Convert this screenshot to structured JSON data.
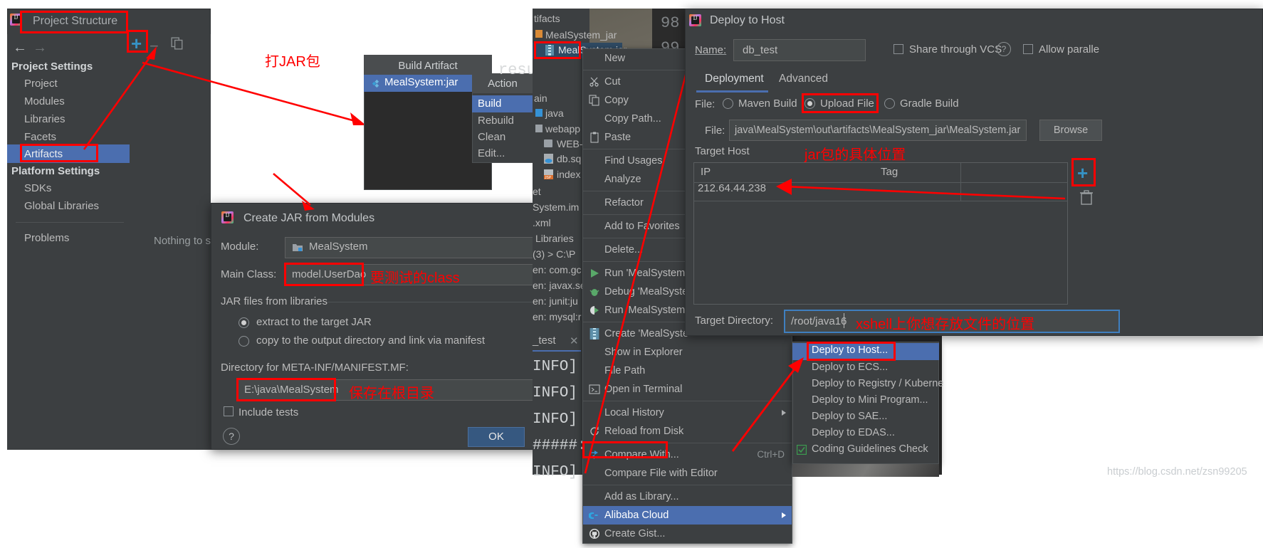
{
  "project_structure": {
    "title": "Project Structure",
    "nav": {
      "back": "←",
      "forward": "→"
    },
    "sections": [
      {
        "header": "Project Settings",
        "items": [
          "Project",
          "Modules",
          "Libraries",
          "Facets",
          "Artifacts"
        ]
      },
      {
        "header": "Platform Settings",
        "items": [
          "SDKs",
          "Global Libraries"
        ]
      }
    ],
    "problems": "Problems",
    "selected_item": "Artifacts",
    "toolbar": {
      "add": "+",
      "remove": "−",
      "copy": "copy-icon"
    },
    "empty_text": "Nothing to s"
  },
  "annotations": {
    "jar_note": "打JAR包",
    "class_note": "要测试的class",
    "root_dir_note": "保存在根目录",
    "jar_location_note": "jar包的具体位置",
    "xshell_note": "xshell上你想存放文件的位置"
  },
  "build_artifact": {
    "title": "Build Artifact",
    "item": "MealSystem:jar",
    "arrow": "▶"
  },
  "action_menu": {
    "title": "Action",
    "items": [
      "Build",
      "Rebuild",
      "Clean",
      "Edit..."
    ],
    "selected": "Build"
  },
  "create_jar_dialog": {
    "title": "Create JAR from Modules",
    "module_label": "Module:",
    "module_value": "MealSystem",
    "main_class_label": "Main Class:",
    "main_class_value": "model.UserDao",
    "jar_files_group": "JAR files from libraries",
    "radio_extract": "extract to the target JAR",
    "radio_copy": "copy to the output directory and link via manifest",
    "selected_radio": "extract to the target JAR",
    "manifest_label": "Directory for META-INF/MANIFEST.MF:",
    "manifest_value": "E:\\java\\MealSystem",
    "include_tests": "Include tests",
    "help": "?",
    "ok": "OK"
  },
  "project_tree": {
    "items": [
      "tifacts",
      "MealSystem_jar",
      "MealSystem.jar",
      "ain",
      "java",
      "webapp",
      "WEB-I",
      "db.sq",
      "index",
      "et",
      "System.im",
      ".xml",
      "Libraries",
      "(3) >   C:\\P",
      "en: com.gc",
      "en: javax.se",
      "en: junit:ju",
      "en: mysql:r",
      "_test"
    ],
    "selected": "MealSystem.jar",
    "line_numbers": [
      "98",
      "99"
    ],
    "console_lines": [
      "INFO]",
      "INFO]",
      "INFO]",
      "INFO]",
      "#####:",
      "INFO]"
    ],
    "path_hint": "C:\\P"
  },
  "context_menu": {
    "items": [
      {
        "label": "New",
        "icon": "",
        "sep_after": true
      },
      {
        "label": "Cut",
        "icon": "scissors-icon"
      },
      {
        "label": "Copy",
        "icon": "copy-icon"
      },
      {
        "label": "Copy Path...",
        "icon": ""
      },
      {
        "label": "Paste",
        "icon": "clipboard-icon",
        "sep_after": true
      },
      {
        "label": "Find Usages",
        "icon": ""
      },
      {
        "label": "Analyze",
        "icon": "",
        "sep_after": true
      },
      {
        "label": "Refactor",
        "icon": "",
        "sep_after": true
      },
      {
        "label": "Add to Favorites",
        "icon": "",
        "sep_after": true
      },
      {
        "label": "Delete...",
        "icon": "",
        "sep_after": true
      },
      {
        "label": "Run 'MealSystem.j",
        "icon": "run-icon"
      },
      {
        "label": "Debug 'MealSyste",
        "icon": "debug-icon"
      },
      {
        "label": "Run 'MealSystem.j",
        "icon": "coverage-icon",
        "sep_after": true
      },
      {
        "label": "Create 'MealSyste",
        "icon": "jar-icon"
      },
      {
        "label": "Show in Explorer",
        "icon": ""
      },
      {
        "label": "File Path",
        "icon": ""
      },
      {
        "label": "Open in Terminal",
        "icon": "terminal-icon",
        "sep_after": true
      },
      {
        "label": "Local History",
        "icon": "",
        "submenu": true
      },
      {
        "label": "Reload from Disk",
        "icon": "reload-icon",
        "sep_after": true
      },
      {
        "label": "Compare With...",
        "icon": "compare-icon",
        "shortcut": "Ctrl+D"
      },
      {
        "label": "Compare File with Editor",
        "icon": "",
        "sep_after": true
      },
      {
        "label": "Add as Library...",
        "icon": ""
      },
      {
        "label": "Alibaba Cloud",
        "icon": "alibaba-icon",
        "submenu": true,
        "selected": true
      },
      {
        "label": "Create Gist...",
        "icon": "github-icon"
      }
    ]
  },
  "alibaba_submenu": {
    "items": [
      {
        "label": "Deploy to Host...",
        "selected": true
      },
      {
        "label": "Deploy to ECS..."
      },
      {
        "label": "Deploy to Registry / Kuberne"
      },
      {
        "label": "Deploy to Mini Program..."
      },
      {
        "label": "Deploy to SAE..."
      },
      {
        "label": "Deploy to EDAS..."
      },
      {
        "label": "Coding Guidelines Check",
        "icon": "guidelines-icon"
      }
    ]
  },
  "deploy_dialog": {
    "title": "Deploy to Host",
    "name_label": "Name:",
    "name_value": "db_test",
    "share_vcs": "Share through VCS",
    "help_icon": "?",
    "allow_parallel": "Allow paralle",
    "tabs": [
      "Deployment",
      "Advanced"
    ],
    "active_tab": "Deployment",
    "file_row_label": "File:",
    "radios": [
      "Maven Build",
      "Upload File",
      "Gradle Build"
    ],
    "selected_radio": "Upload File",
    "file_label": "File:",
    "file_value": "java\\MealSystem\\out\\artifacts\\MealSystem_jar\\MealSystem.jar",
    "browse": "Browse",
    "target_host_label": "Target Host",
    "table_headers": [
      "IP",
      "Tag"
    ],
    "table_rows": [
      {
        "ip": "212.64.44.238",
        "tag": ""
      }
    ],
    "add_icon": "+",
    "delete_icon": "trash-icon",
    "target_dir_label": "Target Directory:",
    "target_dir_value": "/root/java16"
  },
  "watermark": "https://blog.csdn.net/zsn99205",
  "colors": {
    "accent_blue": "#4b6eaf",
    "annotation_red": "#ff0000",
    "panel_bg": "#3c3f41",
    "editor_bg": "#2b2b2b",
    "highlight_box": "#3f7fbf"
  }
}
